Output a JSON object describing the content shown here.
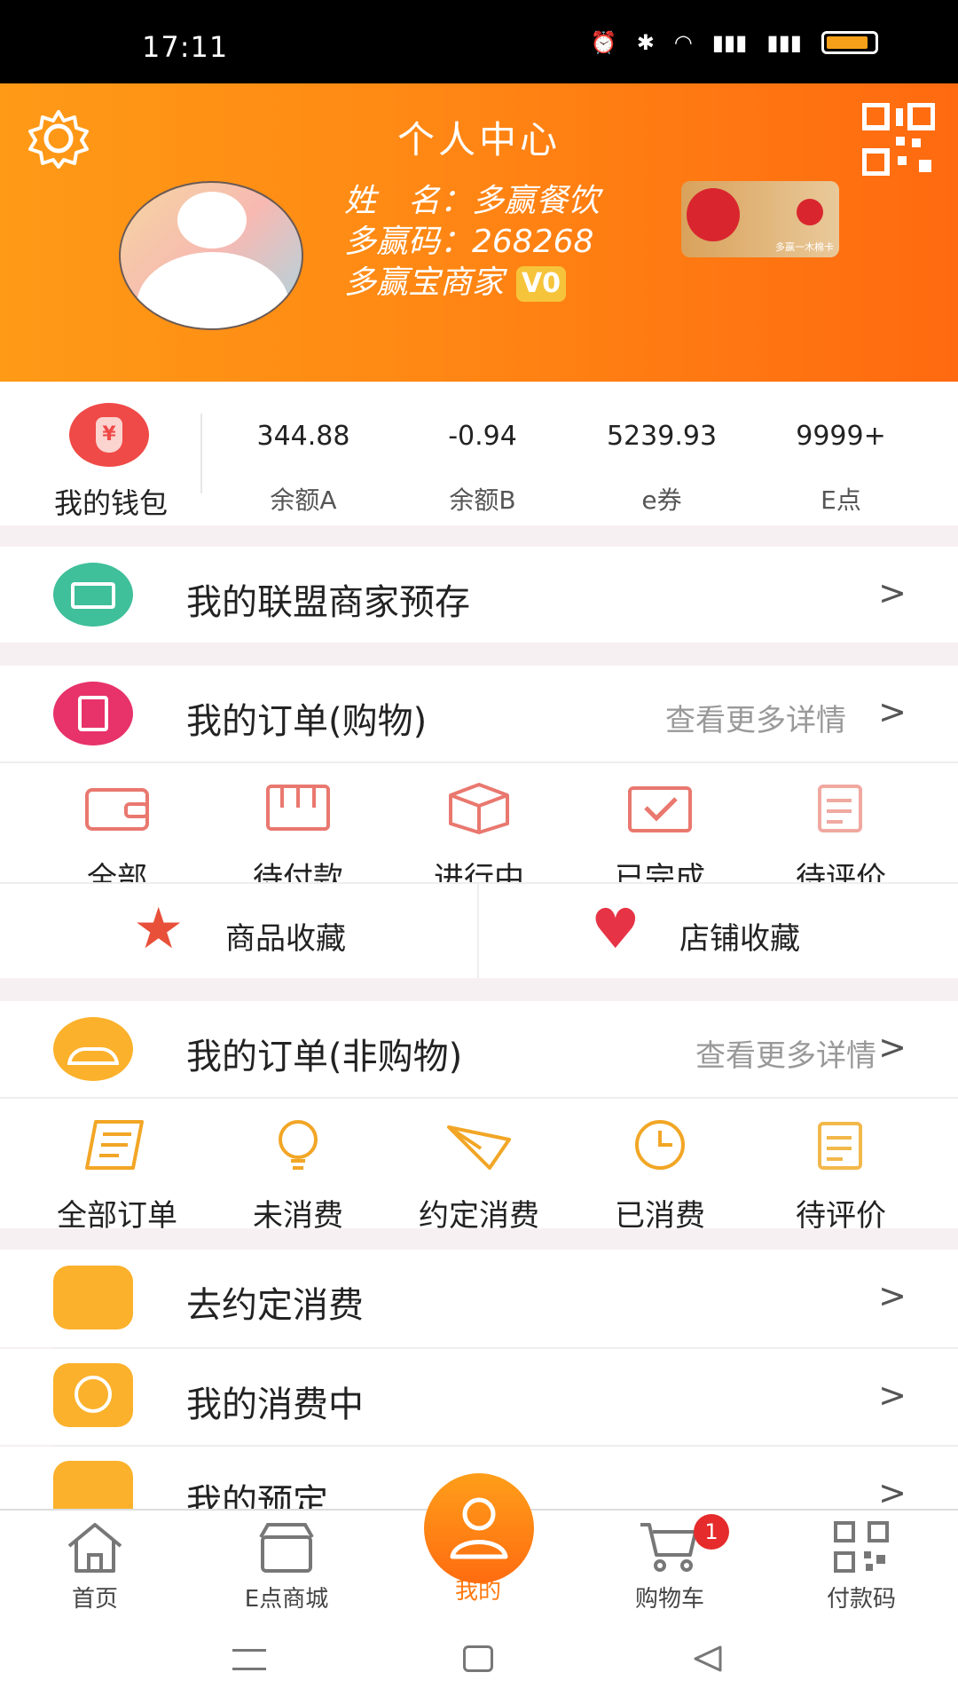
{
  "status": {
    "time": "17:11"
  },
  "header": {
    "title": "个人中心",
    "name_line": "姓　名：多赢餐饮",
    "code_line": "多赢码：268268",
    "type_line": "多赢宝商家",
    "vip_badge": "V0",
    "card_text": "多赢一木棉卡"
  },
  "wallet": {
    "label": "我的钱包",
    "stats": [
      {
        "value": "344.88",
        "label": "余额A"
      },
      {
        "value": "-0.94",
        "label": "余额B"
      },
      {
        "value": "5239.93",
        "label": "e券"
      },
      {
        "value": "9999+",
        "label": "E点"
      }
    ]
  },
  "alliance": {
    "label": "我的联盟商家预存",
    "chevron": ">"
  },
  "orders_shop": {
    "label": "我的订单(购物)",
    "more": "查看更多详情",
    "chevron": ">",
    "items": [
      {
        "label": "全部"
      },
      {
        "label": "待付款"
      },
      {
        "label": "进行中"
      },
      {
        "label": "已完成"
      },
      {
        "label": "待评价"
      }
    ]
  },
  "favorites": {
    "goods": "商品收藏",
    "shop": "店铺收藏"
  },
  "orders_other": {
    "label": "我的订单(非购物)",
    "more": "查看更多详情",
    "chevron": ">",
    "items": [
      {
        "label": "全部订单"
      },
      {
        "label": "未消费"
      },
      {
        "label": "约定消费"
      },
      {
        "label": "已消费"
      },
      {
        "label": "待评价"
      }
    ]
  },
  "list": [
    {
      "label": "去约定消费",
      "chevron": ">"
    },
    {
      "label": "我的消费中",
      "chevron": ">"
    },
    {
      "label": "我的预定",
      "chevron": ">"
    }
  ],
  "nav": {
    "items": [
      {
        "label": "首页"
      },
      {
        "label": "E点商城"
      },
      {
        "label": "我的"
      },
      {
        "label": "购物车"
      },
      {
        "label": "付款码"
      }
    ],
    "cart_badge": "1"
  },
  "colors": {
    "accent": "#ff8a14",
    "icon_orange": "#fbb12b",
    "icon_pink": "#e8326a",
    "icon_red": "#e9786f"
  }
}
